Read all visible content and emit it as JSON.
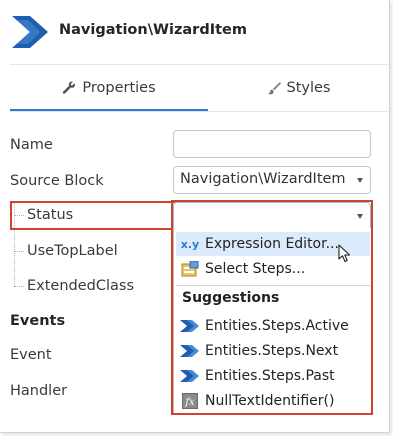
{
  "header": {
    "title": "Navigation\\WizardItem",
    "icon": "wizard-item-chevron-icon"
  },
  "tabs": [
    {
      "label": "Properties",
      "icon": "wrench-icon",
      "selected": true
    },
    {
      "label": "Styles",
      "icon": "brush-icon",
      "selected": false
    }
  ],
  "properties": {
    "name": {
      "label": "Name",
      "value": ""
    },
    "source_block": {
      "label": "Source Block",
      "value": "Navigation\\WizardItem"
    },
    "status": {
      "label": "Status",
      "value": ""
    },
    "use_top_label": {
      "label": "UseTopLabel"
    },
    "extended_class": {
      "label": "ExtendedClass"
    }
  },
  "events": {
    "heading": "Events",
    "event_label": "Event",
    "handler_label": "Handler"
  },
  "dropdown": {
    "actions": [
      {
        "label": "Expression Editor...",
        "icon": "expression-xy-icon",
        "hovered": true
      },
      {
        "label": "Select Steps...",
        "icon": "select-steps-icon",
        "hovered": false
      }
    ],
    "suggestions_heading": "Suggestions",
    "suggestions": [
      {
        "label": "Entities.Steps.Active",
        "icon": "entity-chevron-icon"
      },
      {
        "label": "Entities.Steps.Next",
        "icon": "entity-chevron-icon"
      },
      {
        "label": "Entities.Steps.Past",
        "icon": "entity-chevron-icon"
      },
      {
        "label": "NullTextIdentifier()",
        "icon": "function-fx-icon"
      }
    ]
  },
  "colors": {
    "accent": "#2d7bd8",
    "highlight": "#d0432b",
    "logo": "#1f5fb0",
    "hover": "#dcebfb"
  }
}
